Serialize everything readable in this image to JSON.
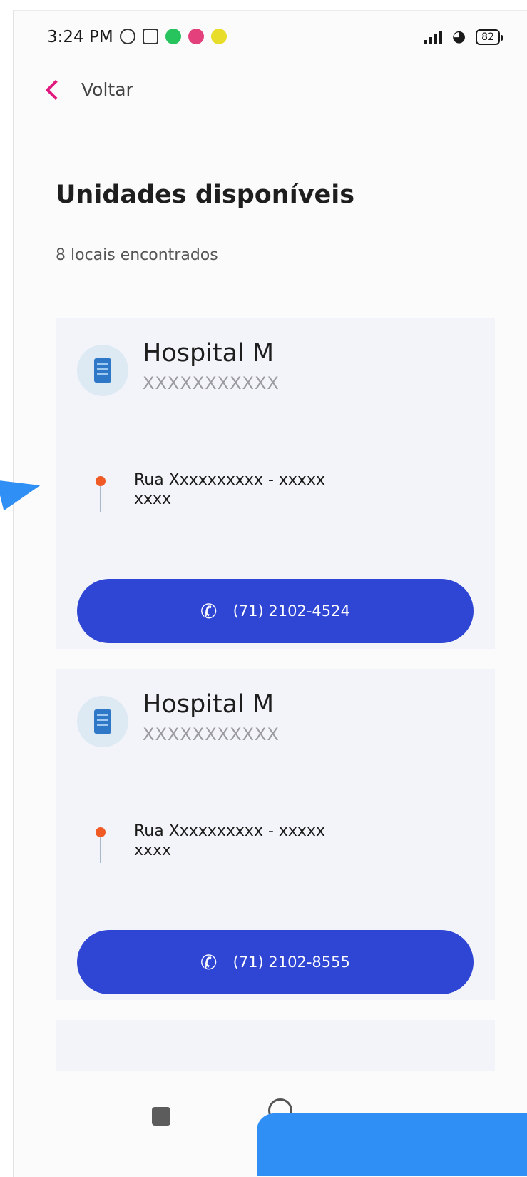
{
  "status_bar": {
    "time": "3:24 PM",
    "battery": "82"
  },
  "nav": {
    "back_label": "Voltar"
  },
  "page": {
    "title": "Unidades disponíveis",
    "count_text": "8 locais encontrados"
  },
  "units": [
    {
      "name": "Hospital M",
      "subtitle": "XXXXXXXXXXX",
      "address_line1": "Rua Xxxxxxxxxx - xxxxx",
      "address_line2": "xxxx",
      "phone": "(71) 2102-4524"
    },
    {
      "name": "Hospital M",
      "subtitle": "XXXXXXXXXXX",
      "address_line1": "Rua Xxxxxxxxxx - xxxxx",
      "address_line2": "xxxx",
      "phone": "(71) 2102-8555"
    }
  ],
  "colors": {
    "accent": "#e0197d",
    "button": "#2e46d3",
    "card_bg": "#f3f4f9",
    "overlay": "#2f8ff5"
  },
  "icons": {
    "back": "chevron-left-icon",
    "unit": "building-icon",
    "address": "map-pin-icon",
    "phone": "phone-icon"
  }
}
